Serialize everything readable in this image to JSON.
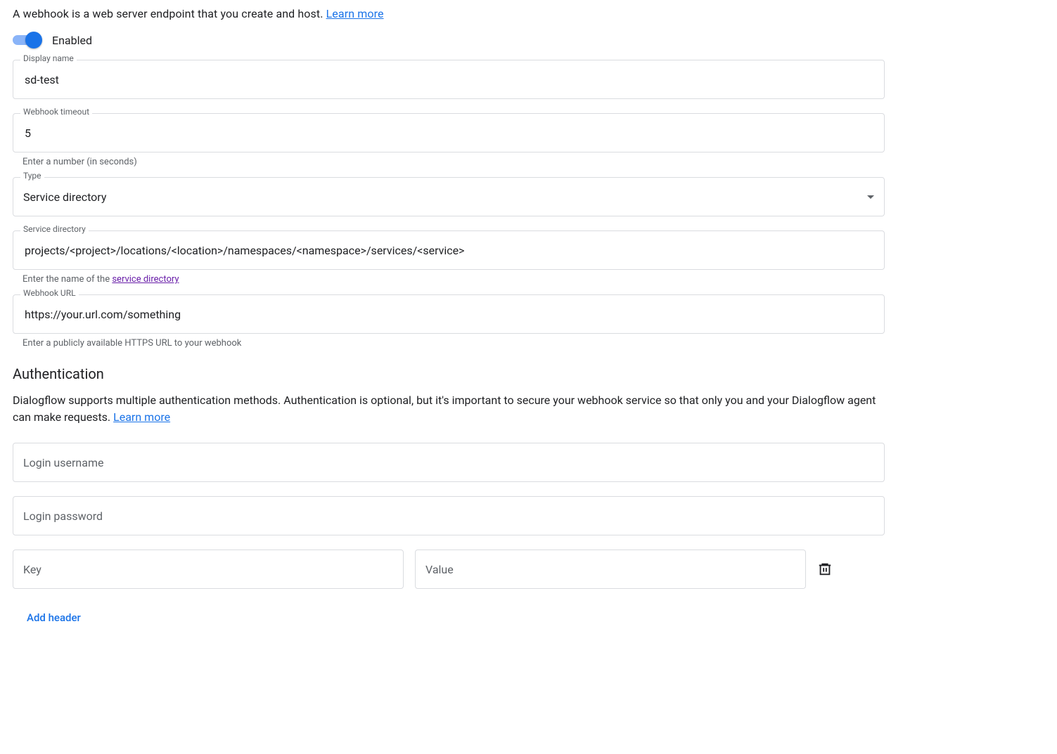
{
  "intro": {
    "text": "A webhook is a web server endpoint that you create and host. ",
    "learn_more": "Learn more"
  },
  "toggle": {
    "label": "Enabled",
    "on": true
  },
  "fields": {
    "display_name": {
      "label": "Display name",
      "value": "sd-test"
    },
    "timeout": {
      "label": "Webhook timeout",
      "value": "5",
      "helper": "Enter a number (in seconds)"
    },
    "type": {
      "label": "Type",
      "value": "Service directory"
    },
    "service_directory": {
      "label": "Service directory",
      "value": "projects/<project>/locations/<location>/namespaces/<namespace>/services/<service>",
      "helper_prefix": "Enter the name of the ",
      "helper_link": "service directory"
    },
    "webhook_url": {
      "label": "Webhook URL",
      "value": "https://your.url.com/something",
      "helper": "Enter a publicly available HTTPS URL to your webhook"
    }
  },
  "auth": {
    "title": "Authentication",
    "desc": "Dialogflow supports multiple authentication methods. Authentication is optional, but it's important to secure your webhook service so that only you and your Dialogflow agent can make requests. ",
    "learn_more": "Learn more",
    "username_placeholder": "Login username",
    "password_placeholder": "Login password",
    "key_placeholder": "Key",
    "value_placeholder": "Value",
    "add_header": "Add header"
  }
}
